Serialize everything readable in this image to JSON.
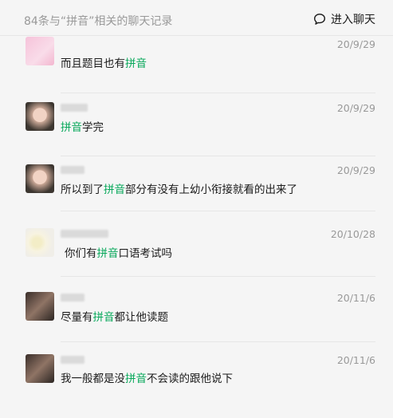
{
  "header": {
    "title": "84条与“拼音”相关的聊天记录",
    "enter_chat_label": "进入聊天"
  },
  "keyword": "拼音",
  "colors": {
    "keyword": "#07a85a",
    "muted": "#999999"
  },
  "messages": [
    {
      "time": "20/9/29",
      "before": "而且题目也有",
      "after": ""
    },
    {
      "time": "20/9/29",
      "before": "",
      "after": "学完"
    },
    {
      "time": "20/9/29",
      "before": "所以到了",
      "after": "部分有没有上幼小衔接就看的出来了"
    },
    {
      "time": "20/10/28",
      "before": "你们有",
      "after": "口语考试吗"
    },
    {
      "time": "20/11/6",
      "before": "尽量有",
      "after": "都让他读题"
    },
    {
      "time": "20/11/6",
      "before": "我一般都是没",
      "after": "不会读的跟他说下"
    }
  ]
}
